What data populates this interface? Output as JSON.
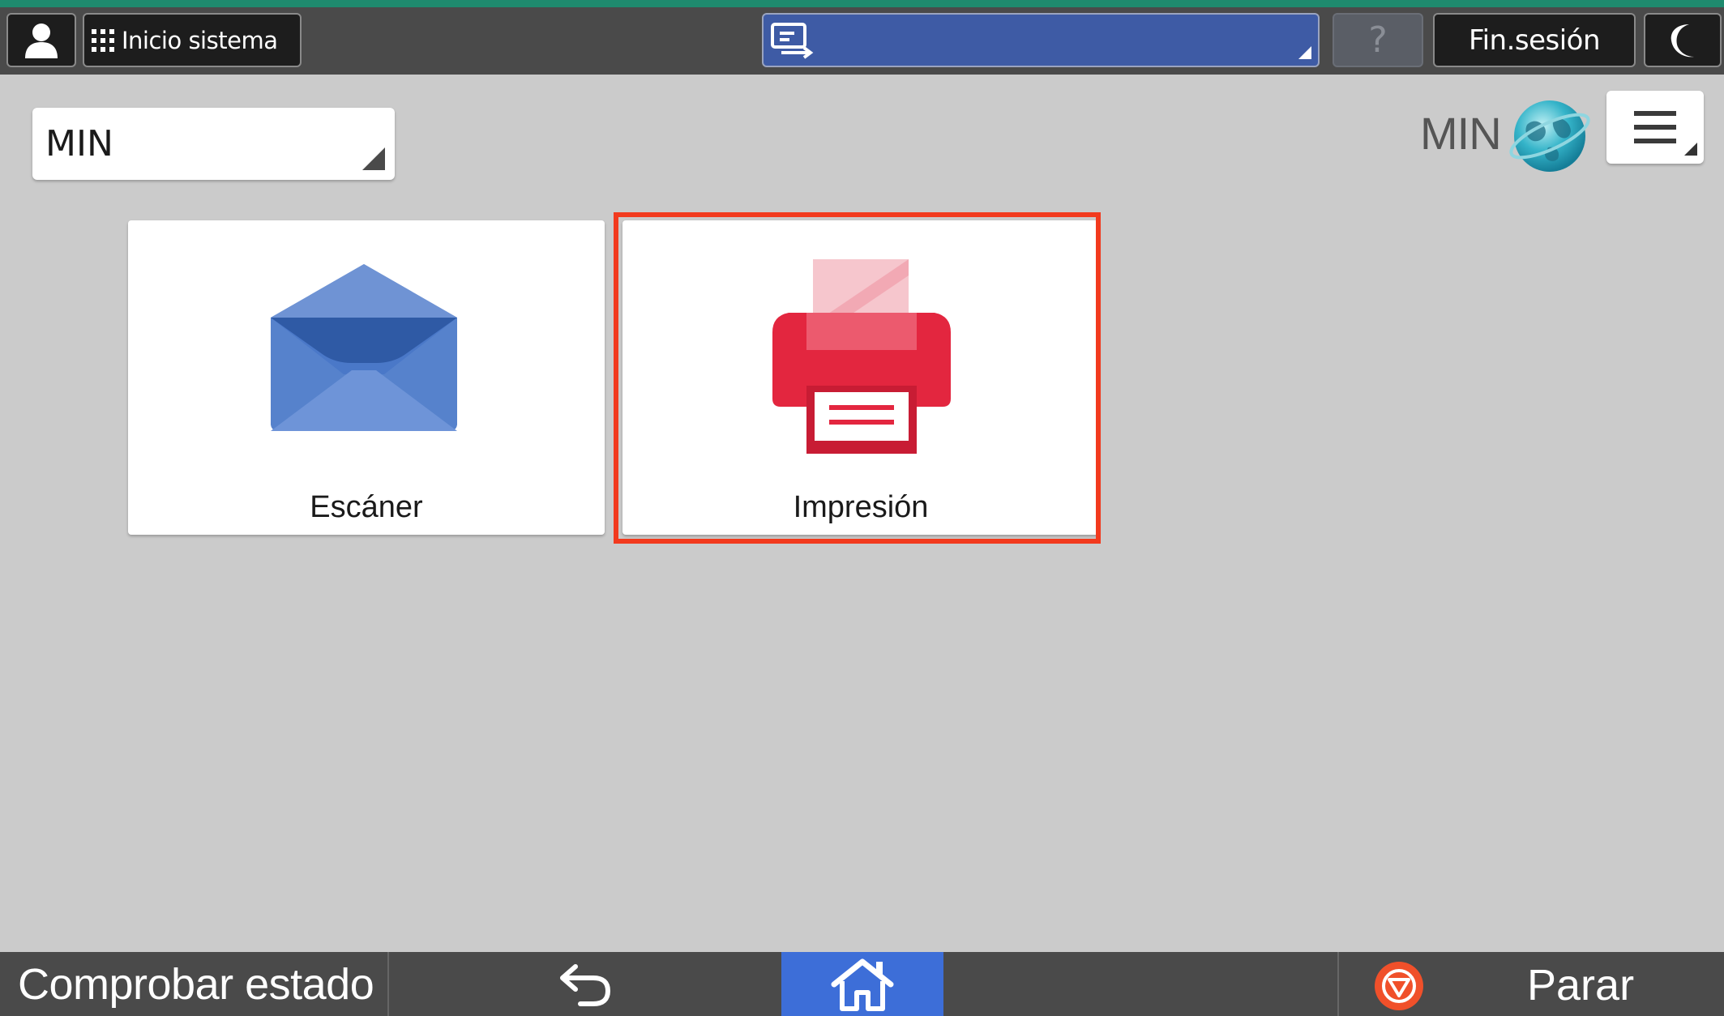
{
  "top_bar": {
    "home_system_label": "Inicio sistema",
    "help_label": "?",
    "logout_label": "Fin.sesión"
  },
  "profile_selector": {
    "value": "MIN"
  },
  "brand": {
    "name": "MIN"
  },
  "apps": [
    {
      "label": "Escáner",
      "icon": "envelope-icon",
      "color": "#4a78c8"
    },
    {
      "label": "Impresión",
      "icon": "printer-icon",
      "color": "#e3263f",
      "selected": true
    }
  ],
  "bottom_bar": {
    "check_status_label": "Comprobar estado",
    "stop_label": "Parar"
  },
  "colors": {
    "accent_top": "#1f8a6e",
    "bar_bg": "#4a4a4a",
    "multitask_bg": "#3e5ba5",
    "home_active": "#3d6ed8",
    "highlight": "#f23a1e",
    "stop": "#f0502a"
  }
}
